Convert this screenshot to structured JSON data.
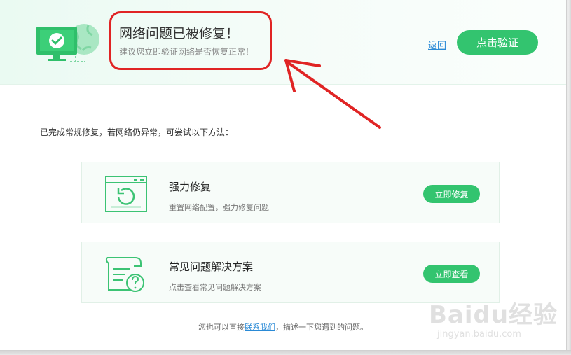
{
  "header": {
    "title": "网络问题已被修复！",
    "subtitle": "建议您立即验证网络是否恢复正常！",
    "back_link": "返回",
    "verify_button": "点击验证"
  },
  "intro": "已完成常规修复，若网络仍异常，可尝试以下方法：",
  "cards": [
    {
      "title": "强力修复",
      "description": "重置网络配置，强力修复问题",
      "button": "立即修复",
      "icon": "window-refresh-icon"
    },
    {
      "title": "常见问题解决方案",
      "description": "点击查看常见问题解决方案",
      "button": "立即查看",
      "icon": "document-question-icon"
    }
  ],
  "footer": {
    "prefix": "您也可以直接",
    "link": "联系我们",
    "suffix": "，描述一下您遇到的问题。"
  },
  "watermark": {
    "brand": "Baidu经验",
    "url": "jingyan.baidu.com"
  },
  "colors": {
    "accent_green": "#33c46f",
    "link_blue": "#2a8ad6",
    "annotation_red": "#e02424",
    "header_bg": "#eafaf2"
  }
}
